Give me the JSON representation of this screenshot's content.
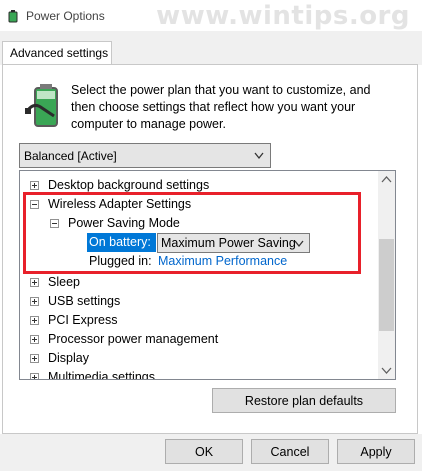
{
  "window": {
    "title": "Power Options",
    "watermark": "www.wintips.org"
  },
  "tabs": [
    {
      "label": "Advanced settings"
    }
  ],
  "intro_text": "Select the power plan that you want to customize, and then choose settings that reflect how you want your computer to manage power.",
  "plan_select": {
    "value": "Balanced [Active]"
  },
  "tree": {
    "items": [
      {
        "label": "Desktop background settings",
        "expander": "plus"
      },
      {
        "label": "Wireless Adapter Settings",
        "expander": "minus"
      },
      {
        "label": "Power Saving Mode",
        "expander": "minus"
      },
      {
        "label": "Sleep",
        "expander": "plus"
      },
      {
        "label": "USB settings",
        "expander": "plus"
      },
      {
        "label": "PCI Express",
        "expander": "plus"
      },
      {
        "label": "Processor power management",
        "expander": "plus"
      },
      {
        "label": "Display",
        "expander": "plus"
      },
      {
        "label": "Multimedia settings",
        "expander": "plus"
      }
    ],
    "on_battery": {
      "label": "On battery:",
      "value": "Maximum Power Saving"
    },
    "plugged_in": {
      "label": "Plugged in:",
      "value": "Maximum Performance"
    }
  },
  "buttons": {
    "restore": "Restore plan defaults",
    "ok": "OK",
    "cancel": "Cancel",
    "apply": "Apply"
  },
  "colors": {
    "highlight": "#e8202a",
    "selection": "#0078d7",
    "link": "#0066cc"
  }
}
